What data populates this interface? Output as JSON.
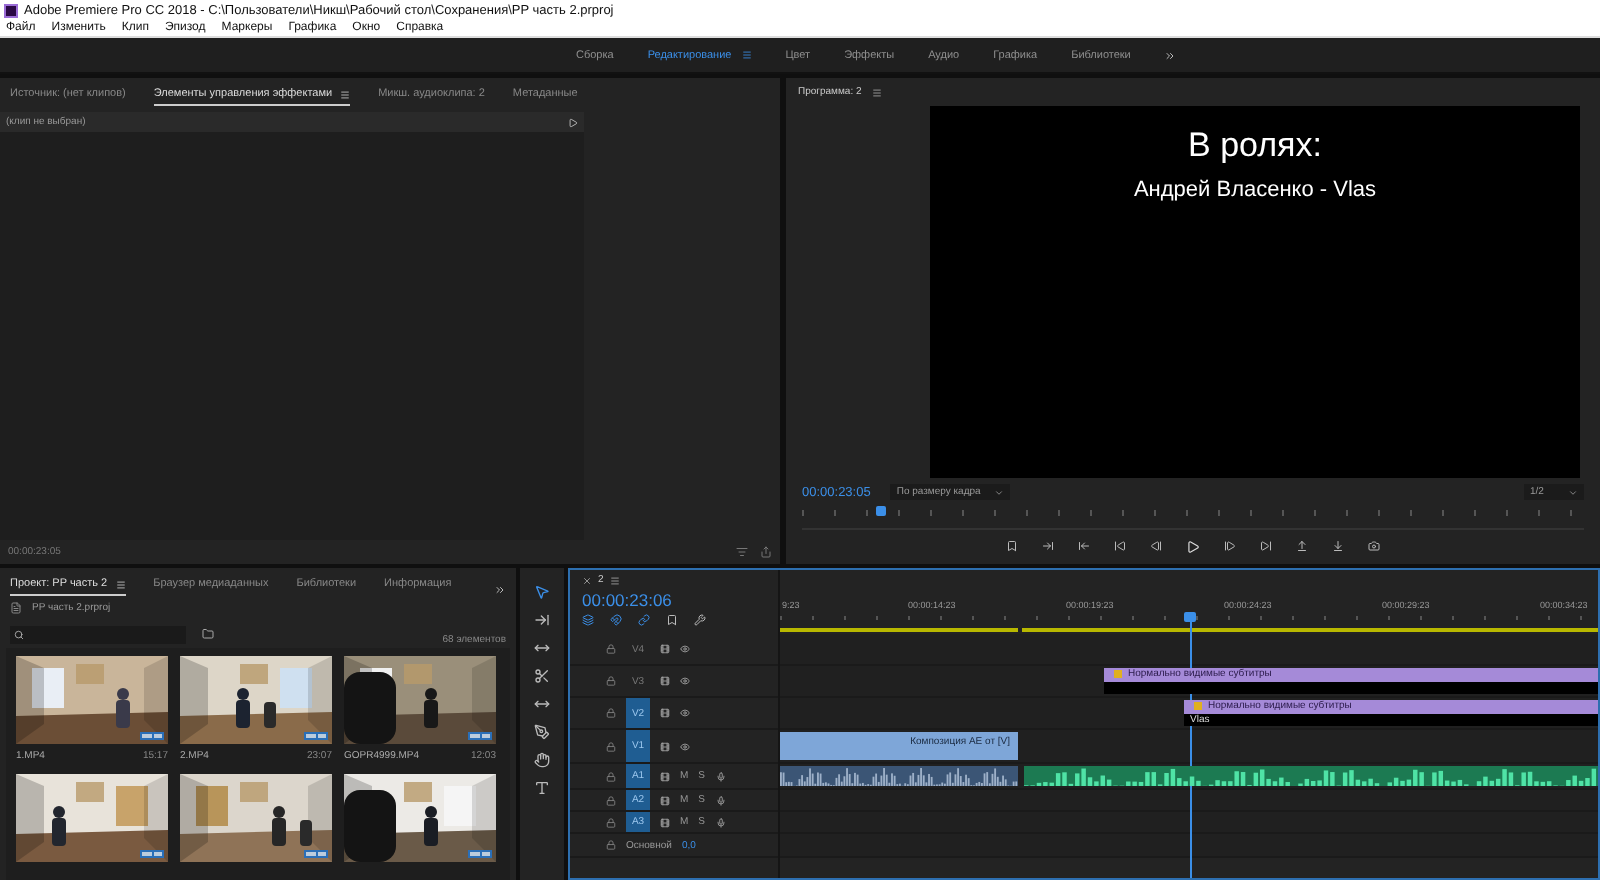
{
  "window": {
    "title": "Adobe Premiere Pro CC 2018 - C:\\Пользователи\\Никш\\Рабочий стол\\Сохранения\\PP часть 2.prproj"
  },
  "menu": [
    "Файл",
    "Изменить",
    "Клип",
    "Эпизод",
    "Маркеры",
    "Графика",
    "Окно",
    "Справка"
  ],
  "workspaces": [
    {
      "label": "Сборка",
      "selected": false
    },
    {
      "label": "Редактирование",
      "selected": true
    },
    {
      "label": "Цвет",
      "selected": false
    },
    {
      "label": "Эффекты",
      "selected": false
    },
    {
      "label": "Аудио",
      "selected": false
    },
    {
      "label": "Графика",
      "selected": false
    },
    {
      "label": "Библиотеки",
      "selected": false
    }
  ],
  "effect_panel": {
    "tabs": [
      {
        "label": "Источник: (нет клипов)",
        "selected": false
      },
      {
        "label": "Элементы управления эффектами",
        "selected": true
      },
      {
        "label": "Микш. аудиоклипа: 2",
        "selected": false
      },
      {
        "label": "Метаданные",
        "selected": false
      }
    ],
    "clip_label": "(клип не выбран)",
    "timecode": "00:00:23:05"
  },
  "program": {
    "title": "Программа: 2",
    "frame_lines": [
      "В ролях:",
      "Андрей Власенко  - Vlas"
    ],
    "timecode": "00:00:23:05",
    "fit": "По размеру кадра",
    "resolution": "1/2",
    "scrubber": {
      "level": 0.1
    }
  },
  "project": {
    "tabs": [
      {
        "label": "Проект: PP часть 2",
        "selected": true
      },
      {
        "label": "Браузер медиаданных",
        "selected": false
      },
      {
        "label": "Библиотеки",
        "selected": false
      },
      {
        "label": "Информация",
        "selected": false
      }
    ],
    "file": "PP часть 2.prproj",
    "count": "68 элементов",
    "items": [
      {
        "kind": "picture",
        "name": "1.MP4",
        "duration": "15:17"
      },
      {
        "kind": "picture",
        "name": "2.MP4",
        "duration": "23:07"
      },
      {
        "kind": "picture",
        "name": "GOPR4999.MP4",
        "duration": "12:03"
      },
      {
        "kind": "picture"
      },
      {
        "kind": "picture"
      },
      {
        "kind": "picture"
      }
    ]
  },
  "timeline": {
    "sequence": "2",
    "timecode": "00:00:23:06",
    "ruler": [
      "9:23",
      "00:00:14:23",
      "00:00:19:23",
      "00:00:24:23",
      "00:00:29:23",
      "00:00:34:23"
    ],
    "playhead": {
      "level": 0.5
    },
    "tracks": [
      {
        "name": "V4",
        "kind": "video",
        "targeted": false
      },
      {
        "name": "V3",
        "kind": "video",
        "targeted": false,
        "clips": [
          {
            "kind": "graphic",
            "label": "Нормально видимые субтитры"
          }
        ]
      },
      {
        "name": "V2",
        "kind": "video",
        "targeted": true,
        "clips": [
          {
            "kind": "graphic",
            "label": "Нормально видимые субтитры",
            "caption": "Vlas"
          }
        ]
      },
      {
        "name": "V1",
        "kind": "video",
        "targeted": true,
        "clips": [
          {
            "kind": "nested",
            "label": "Композиция AE от [V]"
          }
        ]
      },
      {
        "name": "A1",
        "kind": "audio",
        "targeted": true,
        "mute": "M",
        "solo": "S",
        "clips": [
          {
            "kind": "linked-audio"
          },
          {
            "kind": "audio"
          }
        ]
      },
      {
        "name": "A2",
        "kind": "audio",
        "targeted": true,
        "mute": "M",
        "solo": "S"
      },
      {
        "name": "A3",
        "kind": "audio",
        "targeted": true,
        "mute": "M",
        "solo": "S"
      }
    ],
    "master": {
      "name": "Основной",
      "value": "0,0"
    }
  }
}
